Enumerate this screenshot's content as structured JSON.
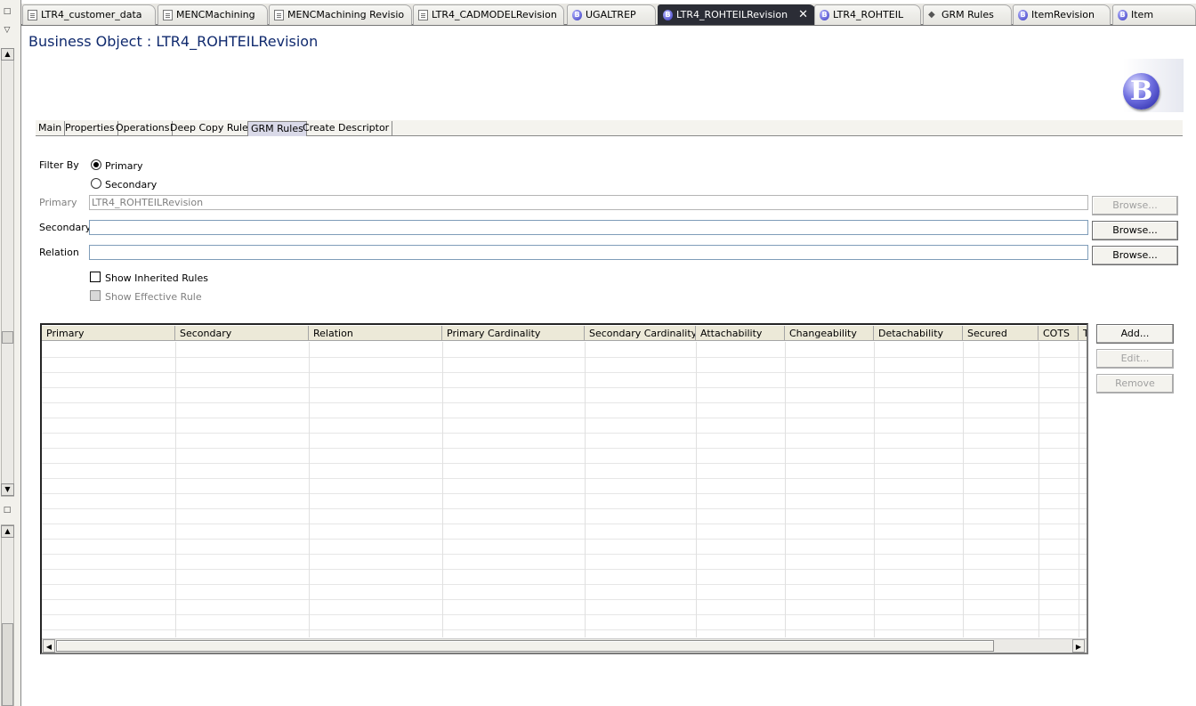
{
  "tabs": [
    {
      "label": "LTR4_customer_data",
      "icon": "document-icon"
    },
    {
      "label": "MENCMachining",
      "icon": "document-icon"
    },
    {
      "label": "MENCMachining Revisio",
      "icon": "document-icon"
    },
    {
      "label": "LTR4_CADMODELRevision",
      "icon": "document-icon"
    },
    {
      "label": "UGALTREP",
      "icon": "business-object-icon"
    },
    {
      "label": "LTR4_ROHTEILRevision",
      "icon": "business-object-icon",
      "active": true
    },
    {
      "label": "LTR4_ROHTEIL",
      "icon": "business-object-icon"
    },
    {
      "label": "GRM Rules",
      "icon": "grm-rules-icon"
    },
    {
      "label": "ItemRevision",
      "icon": "business-object-icon"
    },
    {
      "label": "Item",
      "icon": "business-object-icon"
    }
  ],
  "close_glyph": "✕",
  "header": {
    "title": "Business Object : LTR4_ROHTEILRevision",
    "logo_letter": "B"
  },
  "page_tabs": [
    {
      "label": "Main"
    },
    {
      "label": "Properties"
    },
    {
      "label": "Operations"
    },
    {
      "label": "Deep Copy Rules"
    },
    {
      "label": "GRM Rules",
      "active": true
    },
    {
      "label": "Create Descriptor"
    }
  ],
  "filter": {
    "label": "Filter By",
    "primary_option": "Primary",
    "secondary_option": "Secondary",
    "selected": "Primary"
  },
  "fields": {
    "primary_label": "Primary",
    "primary_value": "LTR4_ROHTEILRevision",
    "secondary_label": "Secondary",
    "secondary_value": "",
    "relation_label": "Relation",
    "relation_value": "",
    "browse_label": "Browse..."
  },
  "options": {
    "show_inherited": "Show Inherited Rules",
    "show_effective": "Show Effective Rule"
  },
  "table": {
    "columns": [
      "Primary",
      "Secondary",
      "Relation",
      "Primary Cardinality",
      "Secondary Cardinality",
      "Attachability",
      "Changeability",
      "Detachability",
      "Secured",
      "COTS",
      "T"
    ],
    "rows": []
  },
  "actions": {
    "add": "Add...",
    "edit": "Edit...",
    "remove": "Remove"
  },
  "colors": {
    "title": "#102a6e",
    "active_tab": "#2b2d36",
    "page_tab_active": "#d9d9e8"
  }
}
